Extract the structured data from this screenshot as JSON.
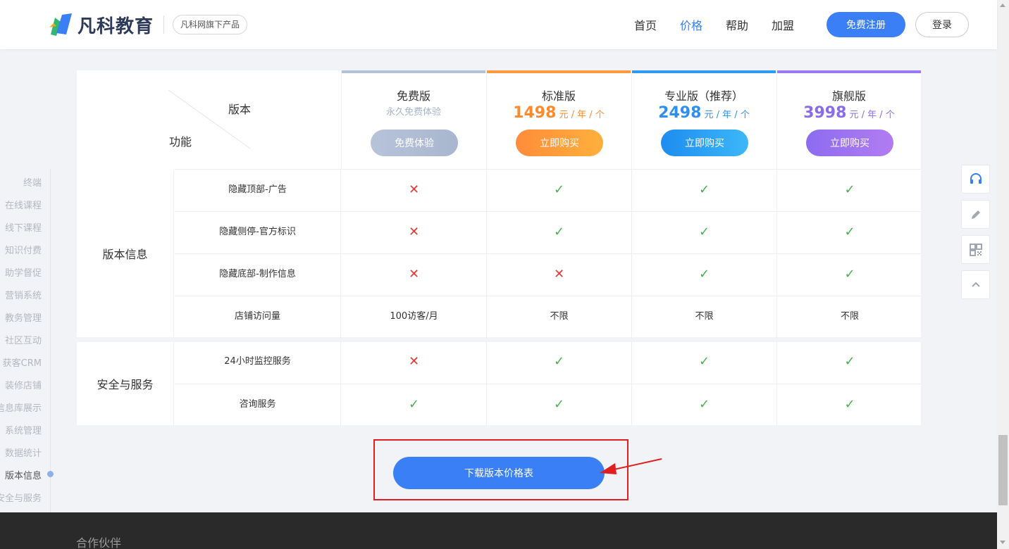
{
  "header": {
    "brand": "凡科教育",
    "badge": "凡科网旗下产品",
    "nav": [
      {
        "label": "首页",
        "active": false
      },
      {
        "label": "价格",
        "active": true
      },
      {
        "label": "帮助",
        "active": false
      },
      {
        "label": "加盟",
        "active": false
      }
    ],
    "register_label": "免费注册",
    "login_label": "登录"
  },
  "sidenav": {
    "items": [
      "终端",
      "在线课程",
      "线下课程",
      "知识付费",
      "助学督促",
      "营销系统",
      "教务管理",
      "社区互动",
      "获客CRM",
      "装修店铺",
      "信息库展示",
      "系统管理",
      "数据统计",
      "版本信息",
      "安全与服务"
    ],
    "active": "版本信息"
  },
  "table": {
    "corner_version": "版本",
    "corner_feature": "功能",
    "plans": [
      {
        "name": "免费版",
        "subtitle": "永久免费体验",
        "price": "",
        "unit": "",
        "button": "免费体验",
        "color": "#b3c1d9"
      },
      {
        "name": "标准版",
        "subtitle": "",
        "price": "1498",
        "unit": "元 / 年 / 个",
        "button": "立即购买",
        "color": "#ff9a3c"
      },
      {
        "name": "专业版（推荐）",
        "subtitle": "",
        "price": "2498",
        "unit": "元 / 年 / 个",
        "button": "立即购买",
        "color": "#2e9bf2"
      },
      {
        "name": "旗舰版",
        "subtitle": "",
        "price": "3998",
        "unit": "元 / 年 / 个",
        "button": "立即购买",
        "color": "#9a7af0"
      }
    ],
    "groups": [
      {
        "label": "版本信息",
        "rows": [
          {
            "feature": "隐藏顶部-广告",
            "values": [
              "no",
              "ok",
              "ok",
              "ok"
            ]
          },
          {
            "feature": "隐藏侧停-官方标识",
            "values": [
              "no",
              "ok",
              "ok",
              "ok"
            ]
          },
          {
            "feature": "隐藏底部-制作信息",
            "values": [
              "no",
              "no",
              "ok",
              "ok"
            ]
          },
          {
            "feature": "店铺访问量",
            "values": [
              "100访客/月",
              "不限",
              "不限",
              "不限"
            ]
          }
        ]
      },
      {
        "label": "安全与服务",
        "rows": [
          {
            "feature": "24小时监控服务",
            "values": [
              "no",
              "ok",
              "ok",
              "ok"
            ]
          },
          {
            "feature": "咨询服务",
            "values": [
              "ok",
              "ok",
              "ok",
              "ok"
            ]
          }
        ]
      }
    ]
  },
  "download_label": "下载版本价格表",
  "tools": [
    "headset-icon",
    "pencil-icon",
    "qrcode-icon",
    "chevron-up-icon"
  ],
  "footer": {
    "title": "合作伙伴"
  },
  "colors": {
    "accent": "#3a7ff5",
    "ok": "#4caf50",
    "no": "#e53935",
    "highlight": "#e02020"
  }
}
